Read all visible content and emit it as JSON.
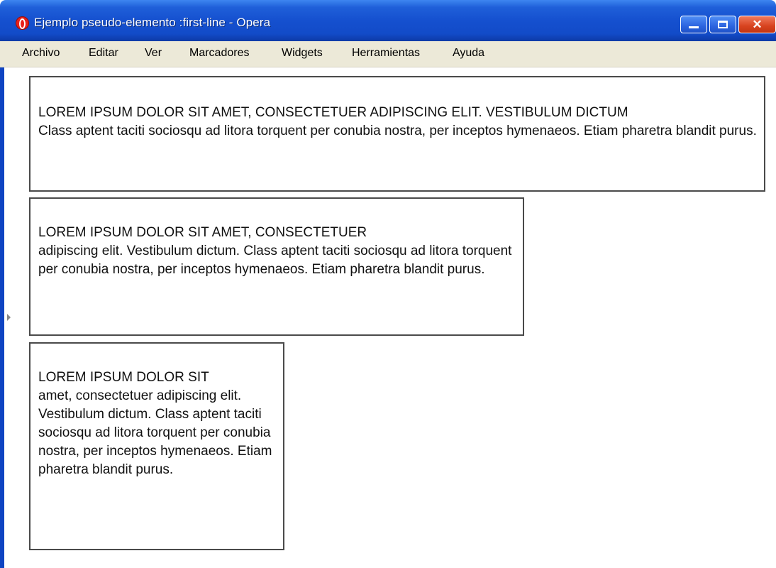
{
  "window": {
    "title": "Ejemplo pseudo-elemento :first-line - Opera",
    "controls": {
      "minimize": "",
      "maximize": "",
      "close": "✕"
    }
  },
  "menu": {
    "items": [
      {
        "label": "Archivo"
      },
      {
        "label": "Editar"
      },
      {
        "label": "Ver"
      },
      {
        "label": "Marcadores"
      },
      {
        "label": "Widgets"
      },
      {
        "label": "Herramientas"
      },
      {
        "label": "Ayuda"
      }
    ]
  },
  "content": {
    "boxes": [
      {
        "first_line": "LOREM IPSUM DOLOR SIT AMET, CONSECTETUER ADIPISCING ELIT. VESTIBULUM DICTUM",
        "rest": "Class aptent taciti sociosqu ad litora torquent per conubia nostra, per inceptos hymenaeos. Etiam pharetra blandit purus."
      },
      {
        "first_line": "LOREM IPSUM DOLOR SIT AMET, CONSECTETUER",
        "rest": "adipiscing elit. Vestibulum dictum. Class aptent taciti sociosqu ad litora torquent per conubia nostra, per inceptos hymenaeos. Etiam pharetra blandit purus."
      },
      {
        "first_line": "LOREM IPSUM DOLOR SIT",
        "rest": "amet, consectetuer adipiscing elit. Vestibulum dictum. Class aptent taciti sociosqu ad litora torquent per conubia nostra, per inceptos hymenaeos. Etiam pharetra blandit purus."
      }
    ]
  }
}
